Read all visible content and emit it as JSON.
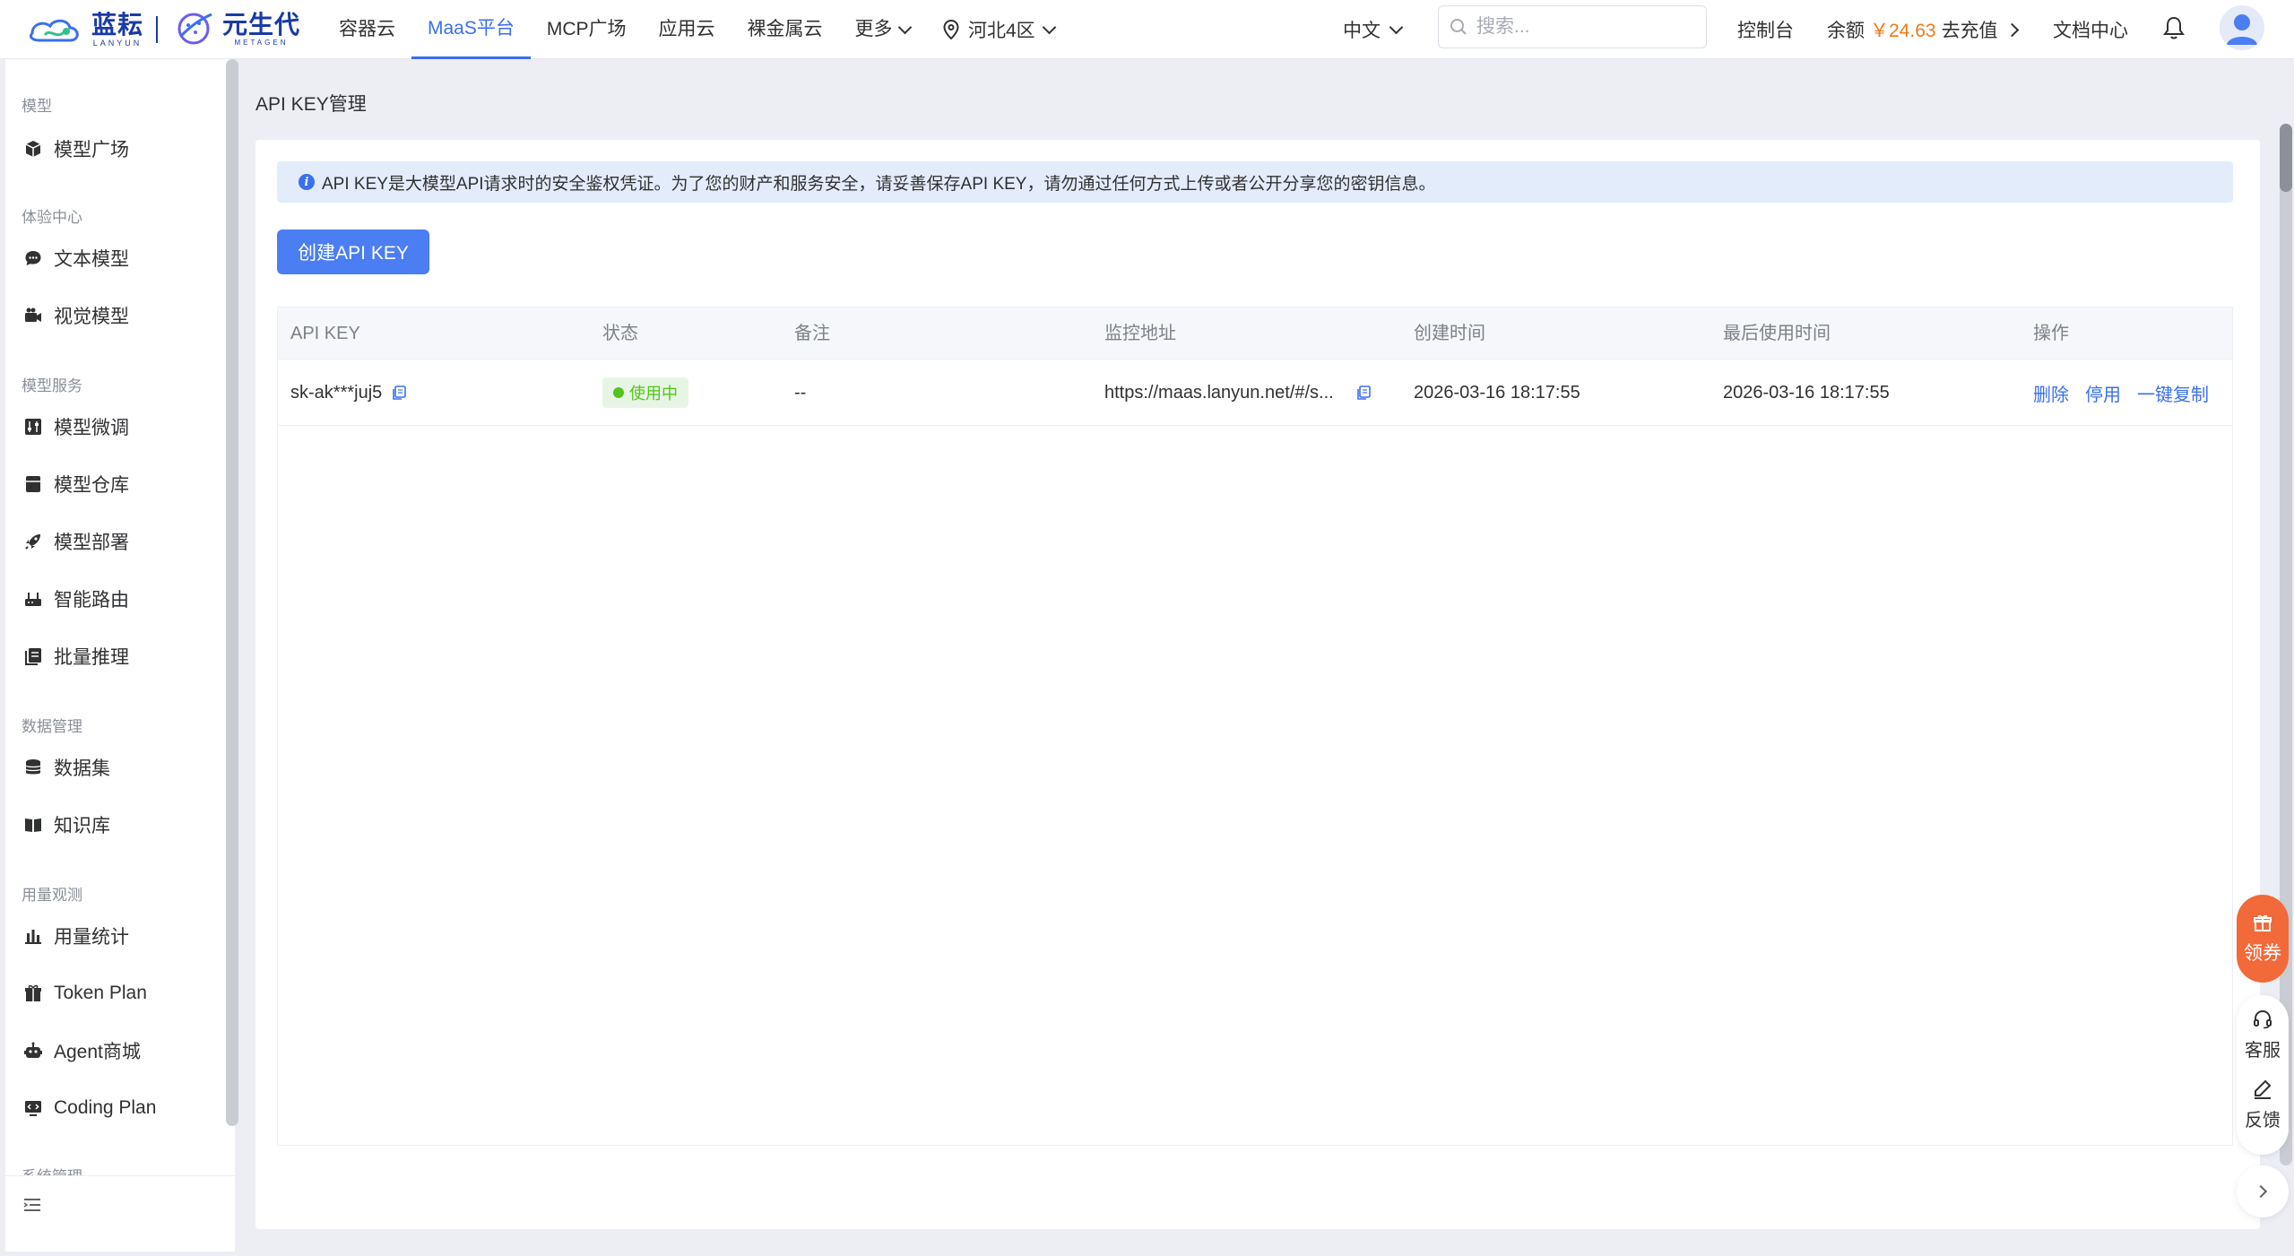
{
  "header": {
    "logo_primary": {
      "cn": "蓝耘",
      "en": "LANYUN"
    },
    "logo_secondary": {
      "cn": "元生代",
      "en": "METAGEN"
    },
    "nav": [
      {
        "label": "容器云",
        "active": false,
        "dropdown": false
      },
      {
        "label": "MaaS平台",
        "active": true,
        "dropdown": false
      },
      {
        "label": "MCP广场",
        "active": false,
        "dropdown": false
      },
      {
        "label": "应用云",
        "active": false,
        "dropdown": false
      },
      {
        "label": "裸金属云",
        "active": false,
        "dropdown": false
      },
      {
        "label": "更多",
        "active": false,
        "dropdown": true
      }
    ],
    "region": "河北4区",
    "language": "中文",
    "search_placeholder": "搜索...",
    "console_label": "控制台",
    "balance_label": "余额",
    "balance_amount": "￥24.63",
    "recharge_label": "去充值",
    "docs_label": "文档中心",
    "accent_color": "#3a6ff0"
  },
  "sidebar": {
    "groups": [
      {
        "title": "模型",
        "items": [
          {
            "label": "模型广场",
            "icon": "cube-icon"
          }
        ]
      },
      {
        "title": "体验中心",
        "items": [
          {
            "label": "文本模型",
            "icon": "chat-bubble-icon"
          },
          {
            "label": "视觉模型",
            "icon": "camera-icon"
          }
        ]
      },
      {
        "title": "模型服务",
        "items": [
          {
            "label": "模型微调",
            "icon": "tune-icon"
          },
          {
            "label": "模型仓库",
            "icon": "box-icon"
          },
          {
            "label": "模型部署",
            "icon": "rocket-icon"
          },
          {
            "label": "智能路由",
            "icon": "router-icon"
          },
          {
            "label": "批量推理",
            "icon": "stack-icon"
          }
        ]
      },
      {
        "title": "数据管理",
        "items": [
          {
            "label": "数据集",
            "icon": "database-icon"
          },
          {
            "label": "知识库",
            "icon": "book-icon"
          }
        ]
      },
      {
        "title": "用量观测",
        "items": [
          {
            "label": "用量统计",
            "icon": "bar-chart-icon"
          },
          {
            "label": "Token Plan",
            "icon": "gift-icon"
          },
          {
            "label": "Agent商城",
            "icon": "robot-icon"
          },
          {
            "label": "Coding Plan",
            "icon": "code-monitor-icon"
          }
        ]
      },
      {
        "title": "系统管理",
        "items": []
      }
    ]
  },
  "main": {
    "breadcrumb": "API KEY管理",
    "alert": "API KEY是大模型API请求时的安全鉴权凭证。为了您的财产和服务安全，请妥善保存API KEY，请勿通过任何方式上传或者公开分享您的密钥信息。",
    "create_button": "创建API KEY",
    "table": {
      "columns": [
        "API KEY",
        "状态",
        "备注",
        "监控地址",
        "创建时间",
        "最后使用时间",
        "操作"
      ],
      "rows": [
        {
          "api_key": "sk-ak***juj5",
          "status": "使用中",
          "status_color": "#52c41a",
          "note": "--",
          "monitor_url": "https://maas.lanyun.net/#/s...",
          "created_at": "2026-03-16 18:17:55",
          "last_used_at": "2026-03-16 18:17:55",
          "actions": [
            "删除",
            "停用",
            "一键复制"
          ]
        }
      ]
    }
  },
  "floating": {
    "coupon_label": "领券",
    "coupon_color": "#f2693a",
    "service_label": "客服",
    "feedback_label": "反馈"
  }
}
